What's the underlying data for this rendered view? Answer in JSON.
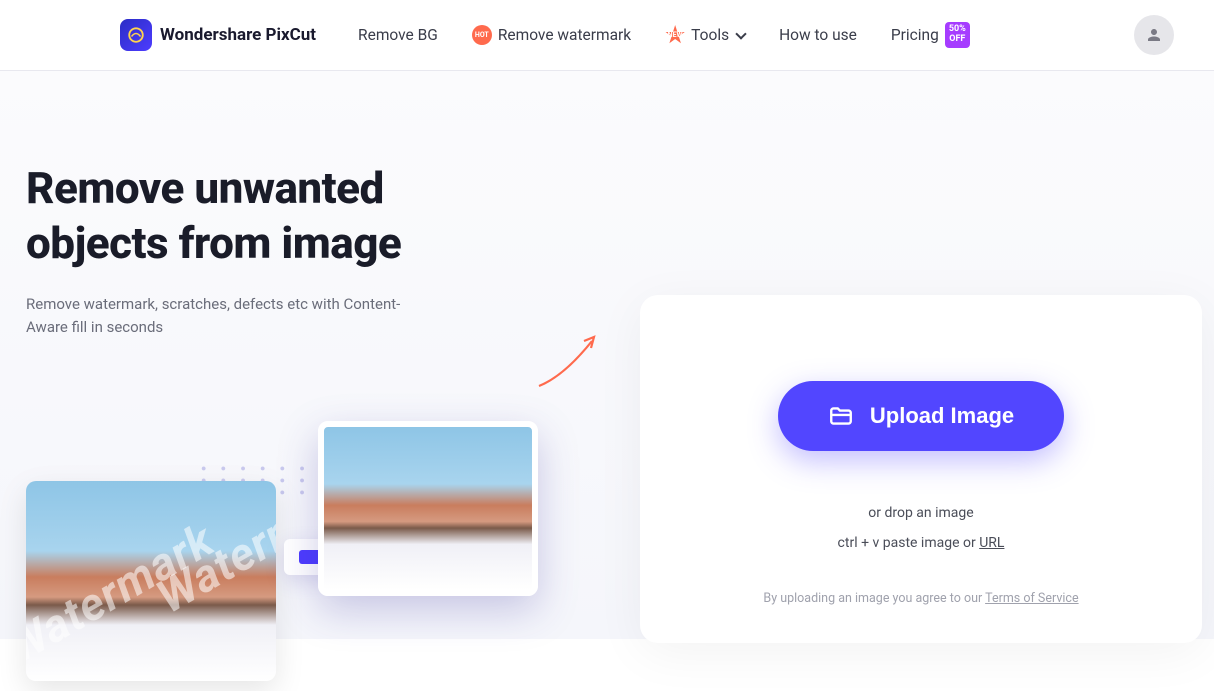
{
  "brand": {
    "name": "Wondershare PixCut"
  },
  "nav": {
    "remove_bg": "Remove BG",
    "remove_watermark": "Remove watermark",
    "hot_badge": "HOT",
    "tools": "Tools",
    "new_badge": "NEW",
    "how_to_use": "How to use",
    "pricing": "Pricing",
    "pricing_badge_line1": "50%",
    "pricing_badge_line2": "OFF"
  },
  "hero": {
    "title_line1": "Remove unwanted",
    "title_line2": "objects from image",
    "subtitle": "Remove watermark, scratches, defects etc with Content-Aware fill in seconds",
    "watermark_overlay": "Watermark"
  },
  "upload": {
    "button_label": "Upload Image",
    "drop_text": "or drop an image",
    "paste_prefix": "ctrl + v paste image or ",
    "paste_url": "URL",
    "terms_prefix": "By uploading an image you agree to our ",
    "terms_link": "Terms of Service"
  }
}
